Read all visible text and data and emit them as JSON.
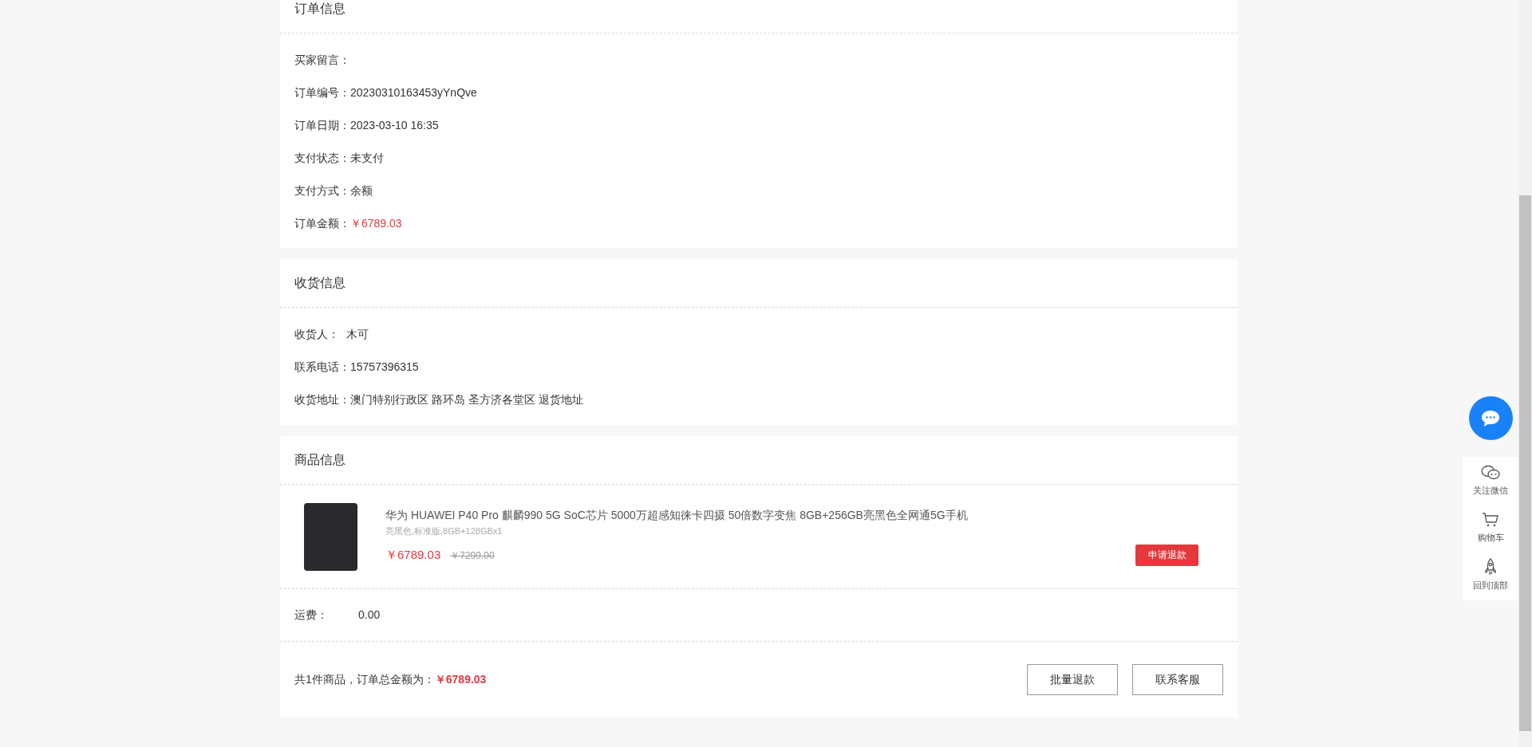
{
  "order_info": {
    "title": "订单信息",
    "rows": [
      {
        "label": "买家留言：",
        "value": "",
        "kind": "plain"
      },
      {
        "label": "订单编号：",
        "value": "20230310163453yYnQve",
        "kind": "plain"
      },
      {
        "label": "订单日期：",
        "value": "2023-03-10 16:35",
        "kind": "plain"
      },
      {
        "label": "支付状态：",
        "value": "未支付",
        "kind": "plain"
      },
      {
        "label": "支付方式：",
        "value": "余额",
        "kind": "plain"
      },
      {
        "label": "订单金额：",
        "value": "￥6789.03",
        "kind": "price"
      }
    ]
  },
  "shipping_info": {
    "title": "收货信息",
    "rows": [
      {
        "label": "收货人：",
        "value": "木可",
        "kind": "spaced"
      },
      {
        "label": "联系电话：",
        "value": "15757396315",
        "kind": "plain"
      },
      {
        "label": "收货地址：",
        "value": "澳门特别行政区 路环岛 圣方济各堂区 退货地址",
        "kind": "plain"
      }
    ]
  },
  "goods_info": {
    "title": "商品信息",
    "items": [
      {
        "name": "华为 HUAWEI P40 Pro 麒麟990 5G SoC芯片 5000万超感知徕卡四摄 50倍数字变焦 8GB+256GB亮黑色全网通5G手机",
        "spec": "亮黑色,标准版,8GB+128GBx1",
        "price": "￥6789.03",
        "original_price": "￥7299.00",
        "action": "申请退款"
      }
    ],
    "freight_label": "运费：",
    "freight": "0.00",
    "summary": {
      "text": "共1件商品，订单总金额为：",
      "total": "￥6789.03"
    },
    "buttons": [
      "批量退款",
      "联系客服"
    ]
  },
  "float_bar": {
    "items": [
      {
        "label": "关注微信",
        "kind": "wechat"
      },
      {
        "label": "购物车",
        "kind": "cart"
      },
      {
        "label": "回到顶部",
        "kind": "top"
      }
    ]
  }
}
